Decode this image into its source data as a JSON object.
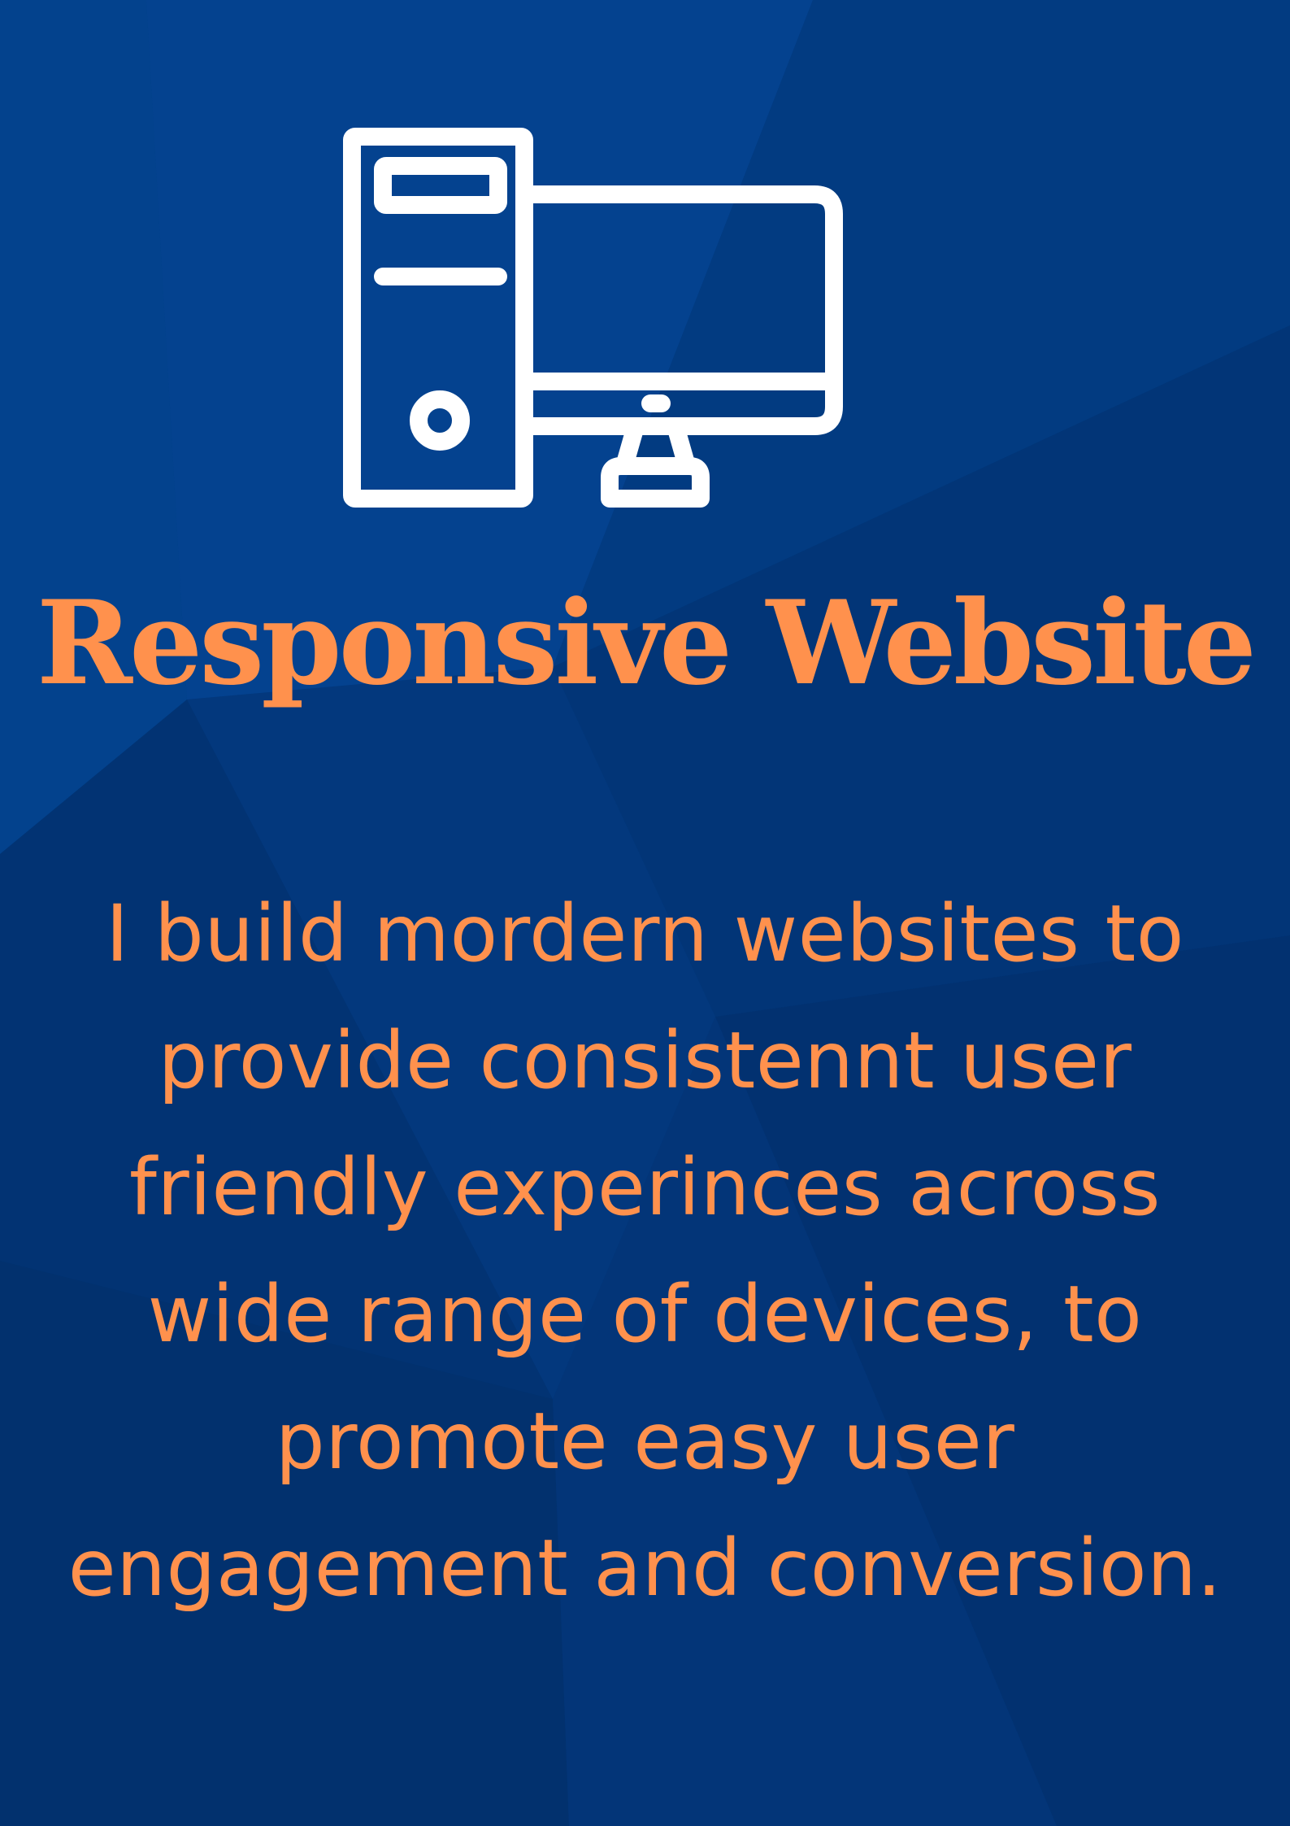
{
  "colors": {
    "background": "#043a80",
    "background_dark": "#022a62",
    "accent": "#ff914d",
    "icon": "#ffffff"
  },
  "icon": {
    "name": "desktop-computer-icon"
  },
  "title": "Responsive Website",
  "body_lines": [
    "I build mordern websites to",
    "provide consistennt user",
    "friendly experinces across",
    "wide range of devices, to",
    "promote easy user",
    "engagement and conversion."
  ]
}
